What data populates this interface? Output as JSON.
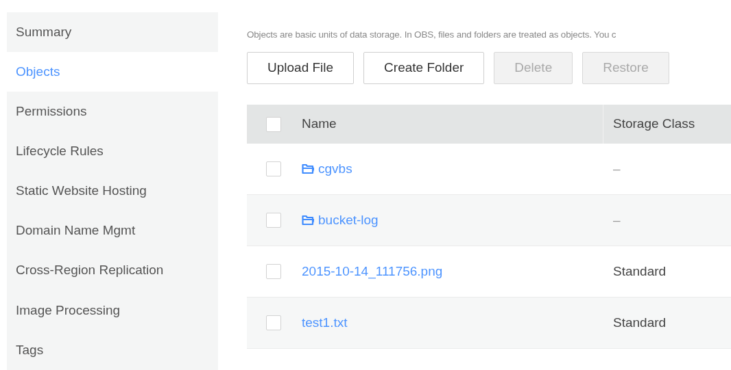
{
  "sidebar": {
    "items": [
      {
        "label": "Summary",
        "selected": false
      },
      {
        "label": "Objects",
        "selected": true
      },
      {
        "label": "Permissions",
        "selected": false
      },
      {
        "label": "Lifecycle Rules",
        "selected": false
      },
      {
        "label": "Static Website Hosting",
        "selected": false
      },
      {
        "label": "Domain Name Mgmt",
        "selected": false
      },
      {
        "label": "Cross-Region Replication",
        "selected": false
      },
      {
        "label": "Image Processing",
        "selected": false
      },
      {
        "label": "Tags",
        "selected": false
      }
    ]
  },
  "description": "Objects are basic units of data storage. In OBS, files and folders are treated as objects. You c",
  "toolbar": [
    {
      "label": "Upload File",
      "disabled": false
    },
    {
      "label": "Create Folder",
      "disabled": false
    },
    {
      "label": "Delete",
      "disabled": true
    },
    {
      "label": "Restore",
      "disabled": true
    }
  ],
  "table": {
    "select_all": {
      "checked": false
    },
    "columns": [
      "Name",
      "Storage Class"
    ],
    "rows": [
      {
        "kind": "folder",
        "checked": false,
        "name": "cgvbs",
        "storage_class": "–"
      },
      {
        "kind": "folder",
        "checked": false,
        "name": "bucket-log",
        "storage_class": "–"
      },
      {
        "kind": "file",
        "checked": false,
        "name": "2015-10-14_111756.png",
        "storage_class": "Standard"
      },
      {
        "kind": "file",
        "checked": false,
        "name": "test1.txt",
        "storage_class": "Standard"
      }
    ]
  }
}
